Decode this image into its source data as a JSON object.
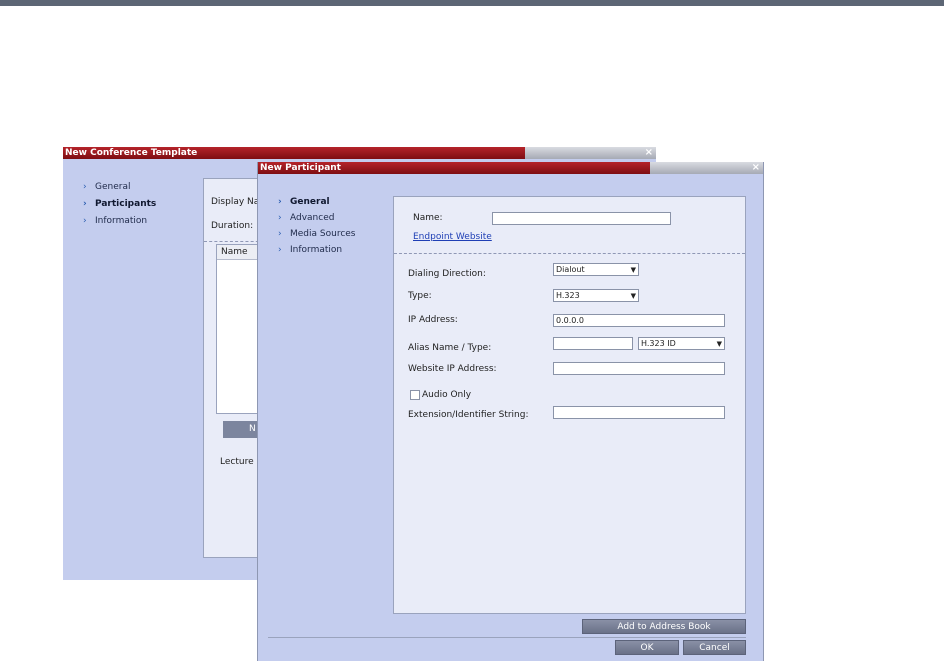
{
  "back_window": {
    "title": "New Conference Template",
    "nav": [
      {
        "label": "General",
        "bold": false
      },
      {
        "label": "Participants",
        "bold": true
      },
      {
        "label": "Information",
        "bold": false
      }
    ],
    "display_name_label": "Display Na",
    "duration_label": "Duration:",
    "list_header": "Name",
    "new_button": "N",
    "lecture_label": "Lecture"
  },
  "front_window": {
    "title": "New Participant",
    "nav": [
      {
        "label": "General",
        "bold": true
      },
      {
        "label": "Advanced",
        "bold": false
      },
      {
        "label": "Media Sources",
        "bold": false
      },
      {
        "label": "Information",
        "bold": false
      }
    ],
    "name_label": "Name:",
    "name_value": "",
    "endpoint_link": "Endpoint Website",
    "dialing_direction_label": "Dialing Direction:",
    "dialing_direction_value": "Dialout",
    "type_label": "Type:",
    "type_value": "H.323",
    "ip_label": "IP Address:",
    "ip_value": "0.0.0.0",
    "alias_label": "Alias Name / Type:",
    "alias_value": "",
    "alias_type_value": "H.323 ID",
    "website_ip_label": "Website IP Address:",
    "website_ip_value": "",
    "audio_only_label": "Audio Only",
    "extension_label": "Extension/Identifier String:",
    "extension_value": "",
    "add_address_book": "Add to Address Book",
    "ok": "OK",
    "cancel": "Cancel"
  },
  "colors": {
    "title_red": "#9a1a1f",
    "panel_blue": "#c4cdee",
    "button_gray": "#7a8198"
  }
}
